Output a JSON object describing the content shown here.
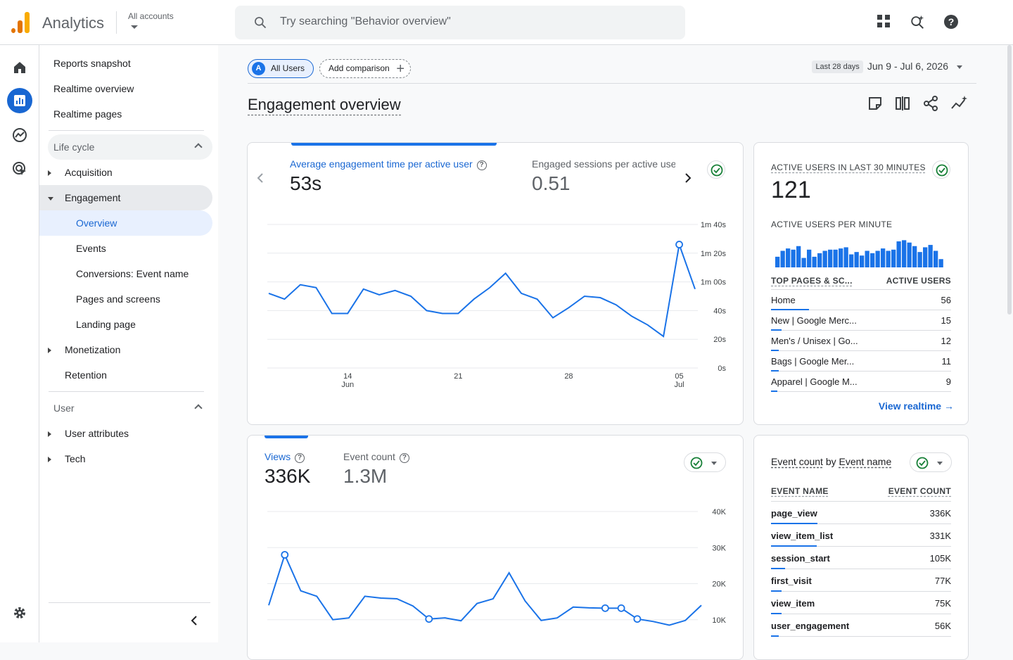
{
  "header": {
    "app_name": "Analytics",
    "accounts_label": "All accounts",
    "search_placeholder": "Try searching \"Behavior overview\""
  },
  "nav": {
    "top_items": [
      "Reports snapshot",
      "Realtime overview",
      "Realtime pages"
    ],
    "lifecycle_label": "Life cycle",
    "acquisition": "Acquisition",
    "engagement": "Engagement",
    "engagement_children": [
      "Overview",
      "Events",
      "Conversions: Event name",
      "Pages and screens",
      "Landing page"
    ],
    "monetization": "Monetization",
    "retention": "Retention",
    "user_label": "User",
    "user_attributes": "User attributes",
    "tech": "Tech"
  },
  "toolbar": {
    "all_users": "All Users",
    "all_users_avatar": "A",
    "add_comparison": "Add comparison",
    "date_label": "Last 28 days",
    "date_range": "Jun 9 - Jul 6, 2026"
  },
  "page": {
    "title": "Engagement overview"
  },
  "card1": {
    "metric1_label": "Average engagement time per active user",
    "metric1_value": "53s",
    "metric2_label": "Engaged sessions per active user",
    "metric2_value": "0.51"
  },
  "card2": {
    "metric1_label": "Views",
    "metric1_value": "336K",
    "metric2_label": "Event count",
    "metric2_value": "1.3M"
  },
  "realtime": {
    "title": "ACTIVE USERS IN LAST 30 MINUTES",
    "value": "121",
    "per_minute_label": "ACTIVE USERS PER MINUTE",
    "col1": "TOP PAGES & SC...",
    "col2": "ACTIVE USERS",
    "rows": [
      {
        "name": "Home",
        "value": "56",
        "share": 1.0
      },
      {
        "name": "New | Google Merc...",
        "value": "15",
        "share": 0.27
      },
      {
        "name": "Men's / Unisex | Go...",
        "value": "12",
        "share": 0.21
      },
      {
        "name": "Bags | Google Mer...",
        "value": "11",
        "share": 0.2
      },
      {
        "name": "Apparel | Google M...",
        "value": "9",
        "share": 0.16
      }
    ],
    "view_link": "View realtime",
    "per_minute_values": [
      9,
      14,
      16,
      15,
      18,
      8,
      15,
      9,
      12,
      14,
      15,
      15,
      16,
      17,
      11,
      13,
      10,
      14,
      12,
      14,
      16,
      14,
      15,
      22,
      23,
      21,
      18,
      13,
      17,
      19,
      14,
      7
    ]
  },
  "events_card": {
    "title_a": "Event count",
    "title_by": "by",
    "title_b": "Event name",
    "col1": "EVENT NAME",
    "col2": "EVENT COUNT",
    "rows": [
      {
        "name": "page_view",
        "value": "336K",
        "share": 1.0
      },
      {
        "name": "view_item_list",
        "value": "331K",
        "share": 0.98
      },
      {
        "name": "session_start",
        "value": "105K",
        "share": 0.31
      },
      {
        "name": "first_visit",
        "value": "77K",
        "share": 0.23
      },
      {
        "name": "view_item",
        "value": "75K",
        "share": 0.22
      },
      {
        "name": "user_engagement",
        "value": "56K",
        "share": 0.17
      }
    ]
  },
  "chart_data": [
    {
      "type": "line",
      "title": "Average engagement time per active user",
      "x": [
        "Jun 9",
        "Jun 10",
        "Jun 11",
        "Jun 12",
        "Jun 13",
        "Jun 14",
        "Jun 15",
        "Jun 16",
        "Jun 17",
        "Jun 18",
        "Jun 19",
        "Jun 20",
        "Jun 21",
        "Jun 22",
        "Jun 23",
        "Jun 24",
        "Jun 25",
        "Jun 26",
        "Jun 27",
        "Jun 28",
        "Jun 29",
        "Jun 30",
        "Jul 1",
        "Jul 2",
        "Jul 3",
        "Jul 4",
        "Jul 5",
        "Jul 6"
      ],
      "values": [
        52,
        48,
        58,
        56,
        38,
        38,
        55,
        51,
        54,
        50,
        40,
        38,
        38,
        48,
        56,
        66,
        52,
        48,
        35,
        42,
        50,
        49,
        44,
        36,
        30,
        22,
        86,
        55
      ],
      "yticks": [
        "0s",
        "20s",
        "40s",
        "1m 00s",
        "1m 20s",
        "1m 40s"
      ],
      "ylim": [
        0,
        100
      ],
      "xticks": [
        {
          "day": "14",
          "month": "Jun"
        },
        {
          "day": "21",
          "month": ""
        },
        {
          "day": "28",
          "month": ""
        },
        {
          "day": "05",
          "month": "Jul"
        }
      ]
    },
    {
      "type": "line",
      "title": "Views",
      "x": [
        "Jun 9",
        "Jun 10",
        "Jun 11",
        "Jun 12",
        "Jun 13",
        "Jun 14",
        "Jun 15",
        "Jun 16",
        "Jun 17",
        "Jun 18",
        "Jun 19",
        "Jun 20",
        "Jun 21",
        "Jun 22",
        "Jun 23",
        "Jun 24",
        "Jun 25",
        "Jun 26",
        "Jun 27",
        "Jun 28",
        "Jun 29",
        "Jun 30",
        "Jul 1",
        "Jul 2",
        "Jul 3",
        "Jul 4",
        "Jul 5",
        "Jul 6"
      ],
      "values": [
        14000,
        28000,
        18000,
        16500,
        10000,
        10500,
        16500,
        16000,
        15800,
        13800,
        10200,
        10500,
        9700,
        14500,
        15800,
        23000,
        15200,
        9800,
        10500,
        13500,
        13300,
        13200,
        13200,
        10200,
        9500,
        8500,
        9800,
        14000
      ],
      "yticks": [
        "10K",
        "20K",
        "30K",
        "40K"
      ],
      "ylim": [
        0,
        40000
      ]
    }
  ]
}
